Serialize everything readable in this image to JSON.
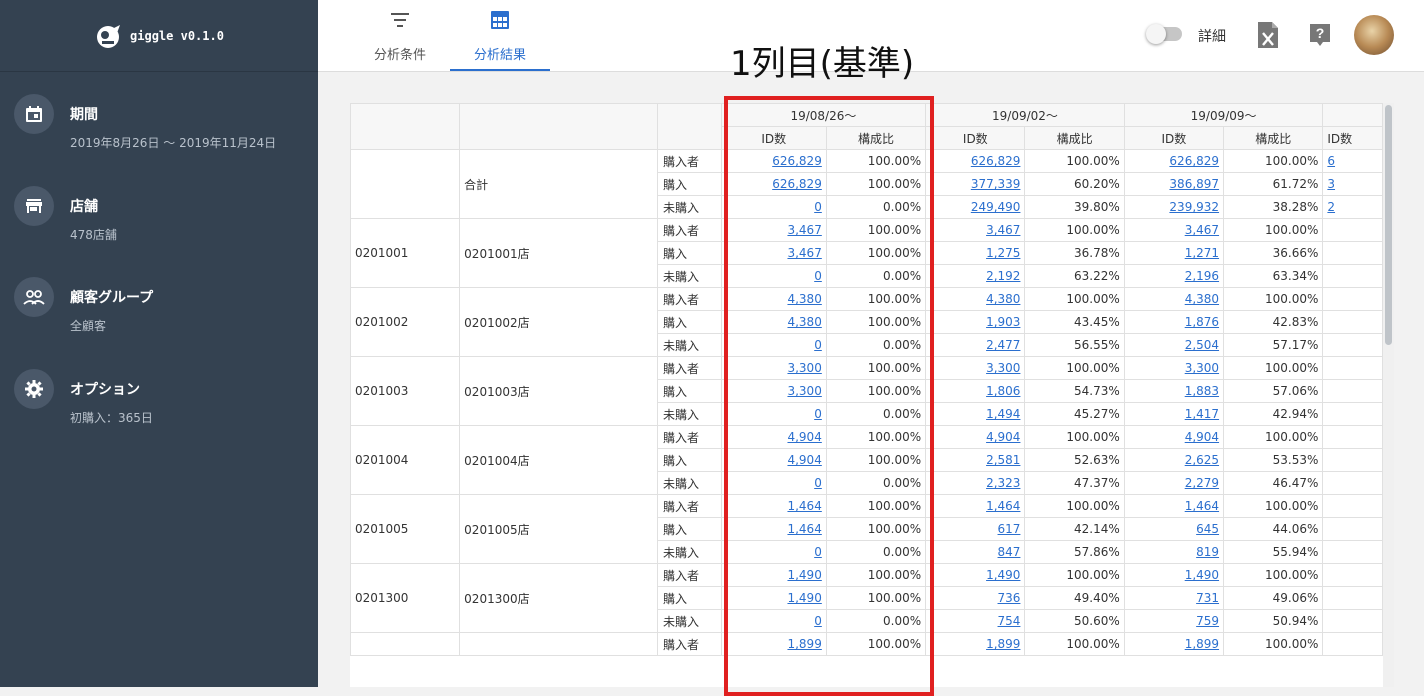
{
  "app": {
    "name": "giggle v0.1.0"
  },
  "sidebar": {
    "items": [
      {
        "title": "期間",
        "sub": "2019年8月26日 ～ 2019年11月24日",
        "icon": "calendar-icon"
      },
      {
        "title": "店舗",
        "sub": "478店舗",
        "icon": "store-icon"
      },
      {
        "title": "顧客グループ",
        "sub": "全顧客",
        "icon": "people-icon"
      },
      {
        "title": "オプション",
        "sub": "初購入：365日",
        "icon": "gear-icon"
      }
    ]
  },
  "header": {
    "tabs": [
      {
        "label": "分析条件",
        "icon": "filter-icon"
      },
      {
        "label": "分析結果",
        "icon": "table-icon"
      }
    ],
    "toggle_label": "詳細",
    "annotation": "1列目(基準)"
  },
  "colors": {
    "sidebar": "#344251",
    "accent": "#2b6fce",
    "highlight": "#e02020"
  },
  "table": {
    "weeks": [
      "19/08/26～",
      "19/09/02～",
      "19/09/09～"
    ],
    "sub_headers": [
      "ID数",
      "構成比"
    ],
    "partial_sub_header": "ID数",
    "types": [
      "購入者",
      "購入",
      "未購入"
    ],
    "groups": [
      {
        "code": "",
        "store": "合計",
        "rows": [
          [
            [
              "626,829",
              "100.00%"
            ],
            [
              "626,829",
              "100.00%"
            ],
            [
              "626,829",
              "100.00%"
            ]
          ],
          [
            [
              "626,829",
              "100.00%"
            ],
            [
              "377,339",
              "60.20%"
            ],
            [
              "386,897",
              "61.72%"
            ]
          ],
          [
            [
              "0",
              "0.00%"
            ],
            [
              "249,490",
              "39.80%"
            ],
            [
              "239,932",
              "38.28%"
            ]
          ]
        ]
      },
      {
        "code": "0201001",
        "store": "0201001店",
        "rows": [
          [
            [
              "3,467",
              "100.00%"
            ],
            [
              "3,467",
              "100.00%"
            ],
            [
              "3,467",
              "100.00%"
            ]
          ],
          [
            [
              "3,467",
              "100.00%"
            ],
            [
              "1,275",
              "36.78%"
            ],
            [
              "1,271",
              "36.66%"
            ]
          ],
          [
            [
              "0",
              "0.00%"
            ],
            [
              "2,192",
              "63.22%"
            ],
            [
              "2,196",
              "63.34%"
            ]
          ]
        ]
      },
      {
        "code": "0201002",
        "store": "0201002店",
        "rows": [
          [
            [
              "4,380",
              "100.00%"
            ],
            [
              "4,380",
              "100.00%"
            ],
            [
              "4,380",
              "100.00%"
            ]
          ],
          [
            [
              "4,380",
              "100.00%"
            ],
            [
              "1,903",
              "43.45%"
            ],
            [
              "1,876",
              "42.83%"
            ]
          ],
          [
            [
              "0",
              "0.00%"
            ],
            [
              "2,477",
              "56.55%"
            ],
            [
              "2,504",
              "57.17%"
            ]
          ]
        ]
      },
      {
        "code": "0201003",
        "store": "0201003店",
        "rows": [
          [
            [
              "3,300",
              "100.00%"
            ],
            [
              "3,300",
              "100.00%"
            ],
            [
              "3,300",
              "100.00%"
            ]
          ],
          [
            [
              "3,300",
              "100.00%"
            ],
            [
              "1,806",
              "54.73%"
            ],
            [
              "1,883",
              "57.06%"
            ]
          ],
          [
            [
              "0",
              "0.00%"
            ],
            [
              "1,494",
              "45.27%"
            ],
            [
              "1,417",
              "42.94%"
            ]
          ]
        ]
      },
      {
        "code": "0201004",
        "store": "0201004店",
        "rows": [
          [
            [
              "4,904",
              "100.00%"
            ],
            [
              "4,904",
              "100.00%"
            ],
            [
              "4,904",
              "100.00%"
            ]
          ],
          [
            [
              "4,904",
              "100.00%"
            ],
            [
              "2,581",
              "52.63%"
            ],
            [
              "2,625",
              "53.53%"
            ]
          ],
          [
            [
              "0",
              "0.00%"
            ],
            [
              "2,323",
              "47.37%"
            ],
            [
              "2,279",
              "46.47%"
            ]
          ]
        ]
      },
      {
        "code": "0201005",
        "store": "0201005店",
        "rows": [
          [
            [
              "1,464",
              "100.00%"
            ],
            [
              "1,464",
              "100.00%"
            ],
            [
              "1,464",
              "100.00%"
            ]
          ],
          [
            [
              "1,464",
              "100.00%"
            ],
            [
              "617",
              "42.14%"
            ],
            [
              "645",
              "44.06%"
            ]
          ],
          [
            [
              "0",
              "0.00%"
            ],
            [
              "847",
              "57.86%"
            ],
            [
              "819",
              "55.94%"
            ]
          ]
        ]
      },
      {
        "code": "0201300",
        "store": "0201300店",
        "rows": [
          [
            [
              "1,490",
              "100.00%"
            ],
            [
              "1,490",
              "100.00%"
            ],
            [
              "1,490",
              "100.00%"
            ]
          ],
          [
            [
              "1,490",
              "100.00%"
            ],
            [
              "736",
              "49.40%"
            ],
            [
              "731",
              "49.06%"
            ]
          ],
          [
            [
              "0",
              "0.00%"
            ],
            [
              "754",
              "50.60%"
            ],
            [
              "759",
              "50.94%"
            ]
          ]
        ]
      },
      {
        "code": "",
        "store": "",
        "rows": [
          [
            [
              "1,899",
              "100.00%"
            ],
            [
              "1,899",
              "100.00%"
            ],
            [
              "1,899",
              "100.00%"
            ]
          ]
        ]
      }
    ],
    "partial_values": [
      "6",
      "3",
      "2"
    ]
  }
}
